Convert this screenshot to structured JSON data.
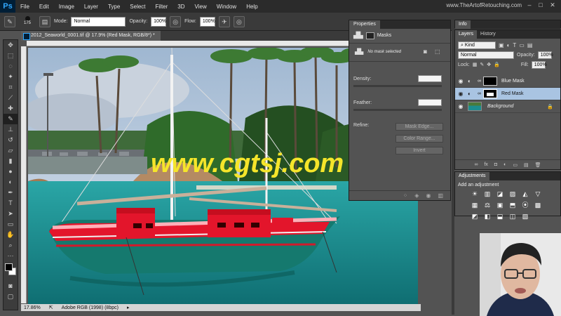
{
  "app": {
    "logo": "Ps",
    "site": "www.TheArtofRetouching.com"
  },
  "menu": [
    "File",
    "Edit",
    "Image",
    "Layer",
    "Type",
    "Select",
    "Filter",
    "3D",
    "View",
    "Window",
    "Help"
  ],
  "window_controls": [
    "–",
    "□",
    "✕"
  ],
  "options": {
    "brush_size": "175",
    "mode_label": "Mode:",
    "mode": "Normal",
    "opacity_label": "Opacity:",
    "opacity": "100%",
    "flow_label": "Flow:",
    "flow": "100%"
  },
  "document": {
    "tab_title": "2012_Seaworld_0001.tif @ 17.9% (Red Mask, RGB/8*) *",
    "zoom": "17.86%",
    "profile": "Adobe RGB (1998) (8bpc)",
    "watermark": "www.cgtsj.com"
  },
  "properties": {
    "tab": "Properties",
    "section": "Masks",
    "status": "No mask selected",
    "density_label": "Density:",
    "feather_label": "Feather:",
    "refine_label": "Refine:",
    "buttons": [
      "Mask Edge...",
      "Color Range...",
      "Invert"
    ]
  },
  "info_panel": {
    "tab": "Info"
  },
  "layers_panel": {
    "tabs": [
      "Layers",
      "History"
    ],
    "filter": "Kind",
    "blend": "Normal",
    "opacity_label": "Opacity:",
    "opacity": "100%",
    "lock_label": "Lock:",
    "fill_label": "Fill:",
    "fill": "100%",
    "layers": [
      {
        "name": "Blue Mask",
        "selected": false
      },
      {
        "name": "Red Mask",
        "selected": true
      },
      {
        "name": "Background",
        "selected": false
      }
    ],
    "footer_icons": [
      "∞",
      "fx",
      "◘",
      "◐",
      "▭",
      "▤",
      "🗑"
    ]
  },
  "adjustments": {
    "tab": "Adjustments",
    "title": "Add an adjustment",
    "icons": [
      "☀",
      "▥",
      "◪",
      "▨",
      "◭",
      "▽",
      "▦",
      "⚖",
      "▣",
      "⬒",
      "⦿",
      "▩",
      "◩",
      "◧",
      "⬓",
      "◫",
      "▧"
    ]
  },
  "colors": {
    "accent": "#31a8ff",
    "boat_red": "#e3152b",
    "water": "#1c8d8f",
    "watermark": "#f5e52a"
  }
}
